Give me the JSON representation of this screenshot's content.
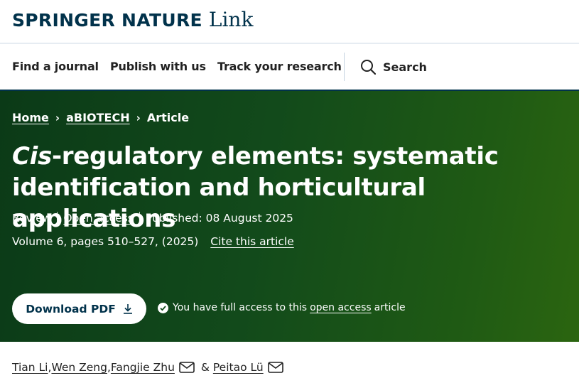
{
  "brand": {
    "publisher": "SPRINGER NATURE",
    "product": "Link"
  },
  "nav": {
    "items": [
      "Find a journal",
      "Publish with us",
      "Track your research"
    ],
    "search_label": "Search"
  },
  "breadcrumb": {
    "home": "Home",
    "journal": "aBIOTECH",
    "current": "Article"
  },
  "article": {
    "title_italic": "Cis",
    "title_rest": "-regulatory elements: systematic identification and horticultural applications",
    "type": "Review",
    "access": "Open access",
    "published": "Published: 08 August 2025",
    "volume": "Volume 6, pages 510–527, (2025)",
    "cite_label": "Cite this article",
    "download_label": "Download PDF",
    "access_note_before": "You have full access to this",
    "access_note_link": "open access",
    "access_note_after": "article"
  },
  "authors": [
    {
      "name": "Tian Li",
      "sep": ", "
    },
    {
      "name": "Wen Zeng",
      "sep": ", "
    },
    {
      "name": "Fangjie Zhu",
      "sep": " & "
    },
    {
      "name": "Peitao Lü",
      "sep": ""
    }
  ],
  "colors": {
    "brand_navy": "#01324b",
    "hero_green": "#124a1b"
  }
}
